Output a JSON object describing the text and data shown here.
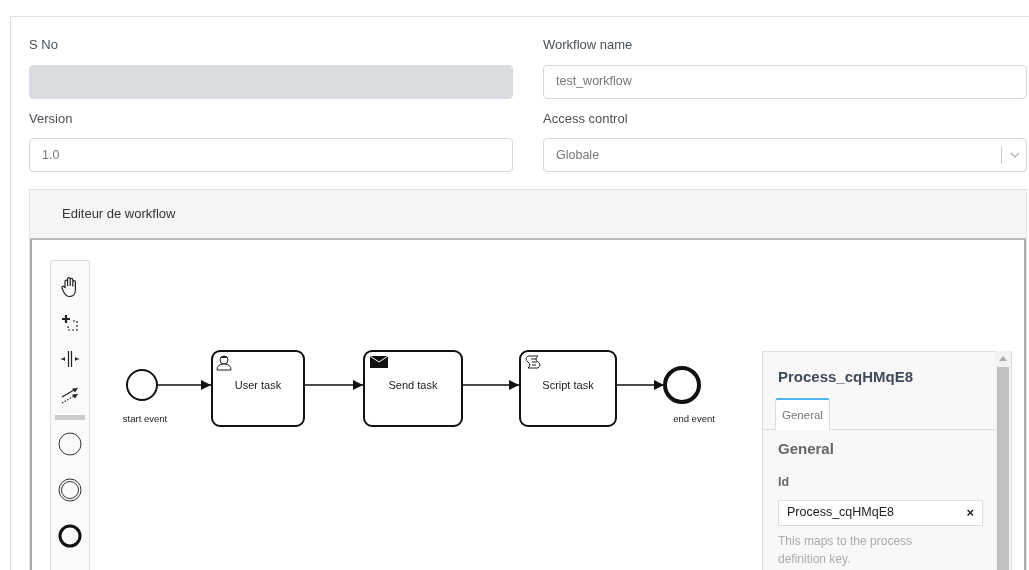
{
  "form": {
    "fields": [
      {
        "label": "S No",
        "kind": "input",
        "disabled": true
      },
      {
        "label": "Workflow name",
        "kind": "input",
        "value": "test_workflow",
        "disabled": false
      },
      {
        "label": "Version",
        "kind": "input",
        "value": "1.0",
        "disabled": false
      },
      {
        "label": "Access control",
        "kind": "select",
        "value": "Globale",
        "disabled": false
      }
    ]
  },
  "editor": {
    "title": "Editeur de workflow",
    "diagram": {
      "nodes": [
        {
          "kind": "start",
          "label": "start event"
        },
        {
          "kind": "user",
          "label": "User task"
        },
        {
          "kind": "send",
          "label": "Send task"
        },
        {
          "kind": "script",
          "label": "Script task"
        },
        {
          "kind": "end",
          "label": "end event"
        }
      ]
    },
    "properties": {
      "title": "Process_cqHMqE8",
      "tabs": [
        {
          "label": "General",
          "selected": true
        }
      ],
      "section": "General",
      "field": {
        "label": "Id",
        "value": "Process_cqHMqE8",
        "clear": "×"
      },
      "description": "This maps to the process definition key."
    }
  }
}
